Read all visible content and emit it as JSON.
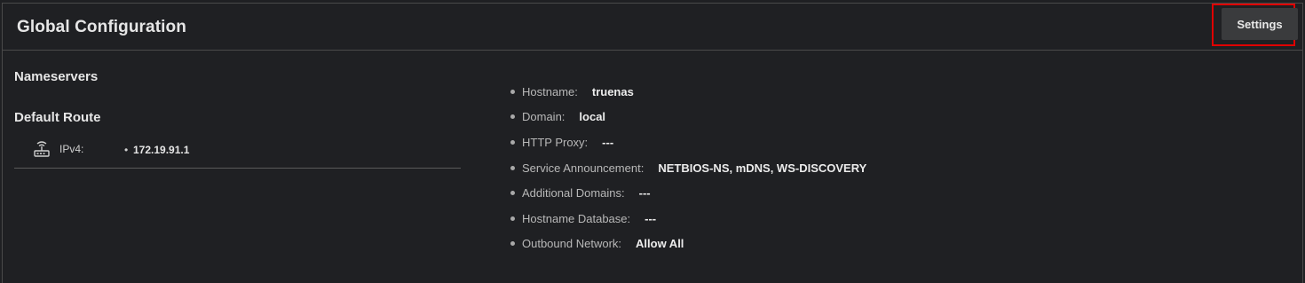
{
  "card": {
    "title": "Global Configuration",
    "settings_label": "Settings"
  },
  "left": {
    "nameservers_heading": "Nameservers",
    "default_route_heading": "Default Route",
    "route": {
      "label": "IPv4:",
      "value": "172.19.91.1",
      "icon": "router-icon"
    }
  },
  "info": [
    {
      "label": "Hostname:",
      "value": "truenas"
    },
    {
      "label": "Domain:",
      "value": "local"
    },
    {
      "label": "HTTP Proxy:",
      "value": "---"
    },
    {
      "label": "Service Announcement:",
      "value": "NETBIOS-NS, mDNS, WS-DISCOVERY"
    },
    {
      "label": "Additional Domains:",
      "value": "---"
    },
    {
      "label": "Hostname Database:",
      "value": "---"
    },
    {
      "label": "Outbound Network:",
      "value": "Allow All"
    }
  ],
  "colors": {
    "background": "#1f2023",
    "highlight": "#e00000",
    "button": "#3a3b3d"
  }
}
